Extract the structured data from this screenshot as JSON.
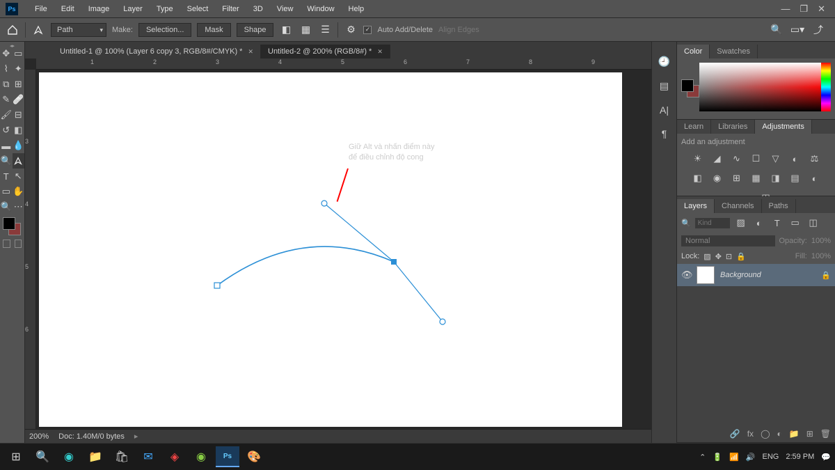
{
  "menubar": {
    "items": [
      "File",
      "Edit",
      "Image",
      "Layer",
      "Type",
      "Select",
      "Filter",
      "3D",
      "View",
      "Window",
      "Help"
    ]
  },
  "optbar": {
    "mode": "Path",
    "make": "Make:",
    "selection": "Selection...",
    "mask": "Mask",
    "shape": "Shape",
    "auto": "Auto Add/Delete",
    "align": "Align Edges"
  },
  "tabs": [
    {
      "title": "Untitled-1 @ 100% (Layer 6 copy 3, RGB/8#/CMYK) *",
      "active": false
    },
    {
      "title": "Untitled-2 @ 200% (RGB/8#) *",
      "active": true
    }
  ],
  "ruler": {
    "marks": [
      "1",
      "2",
      "3",
      "4",
      "5",
      "6",
      "7",
      "8",
      "9"
    ],
    "vmarks": [
      "3",
      "4",
      "5",
      "6"
    ]
  },
  "annotation": {
    "line1": "Giữ Alt và nhấn điểm này",
    "line2": "để điều chỉnh độ cong"
  },
  "status": {
    "zoom": "200%",
    "doc": "Doc: 1.40M/0 bytes"
  },
  "panels": {
    "color": {
      "tabs": [
        "Color",
        "Swatches"
      ]
    },
    "adjust": {
      "tabs": [
        "Learn",
        "Libraries",
        "Adjustments"
      ],
      "hint": "Add an adjustment"
    },
    "layers": {
      "tabs": [
        "Layers",
        "Channels",
        "Paths"
      ],
      "search": "Kind",
      "blend": "Normal",
      "opacity_lbl": "Opacity:",
      "opacity": "100%",
      "lock_lbl": "Lock:",
      "fill_lbl": "Fill:",
      "fill": "100%",
      "items": [
        {
          "name": "Background"
        }
      ]
    }
  },
  "taskbar": {
    "lang": "ENG",
    "time": "2:59 PM"
  }
}
